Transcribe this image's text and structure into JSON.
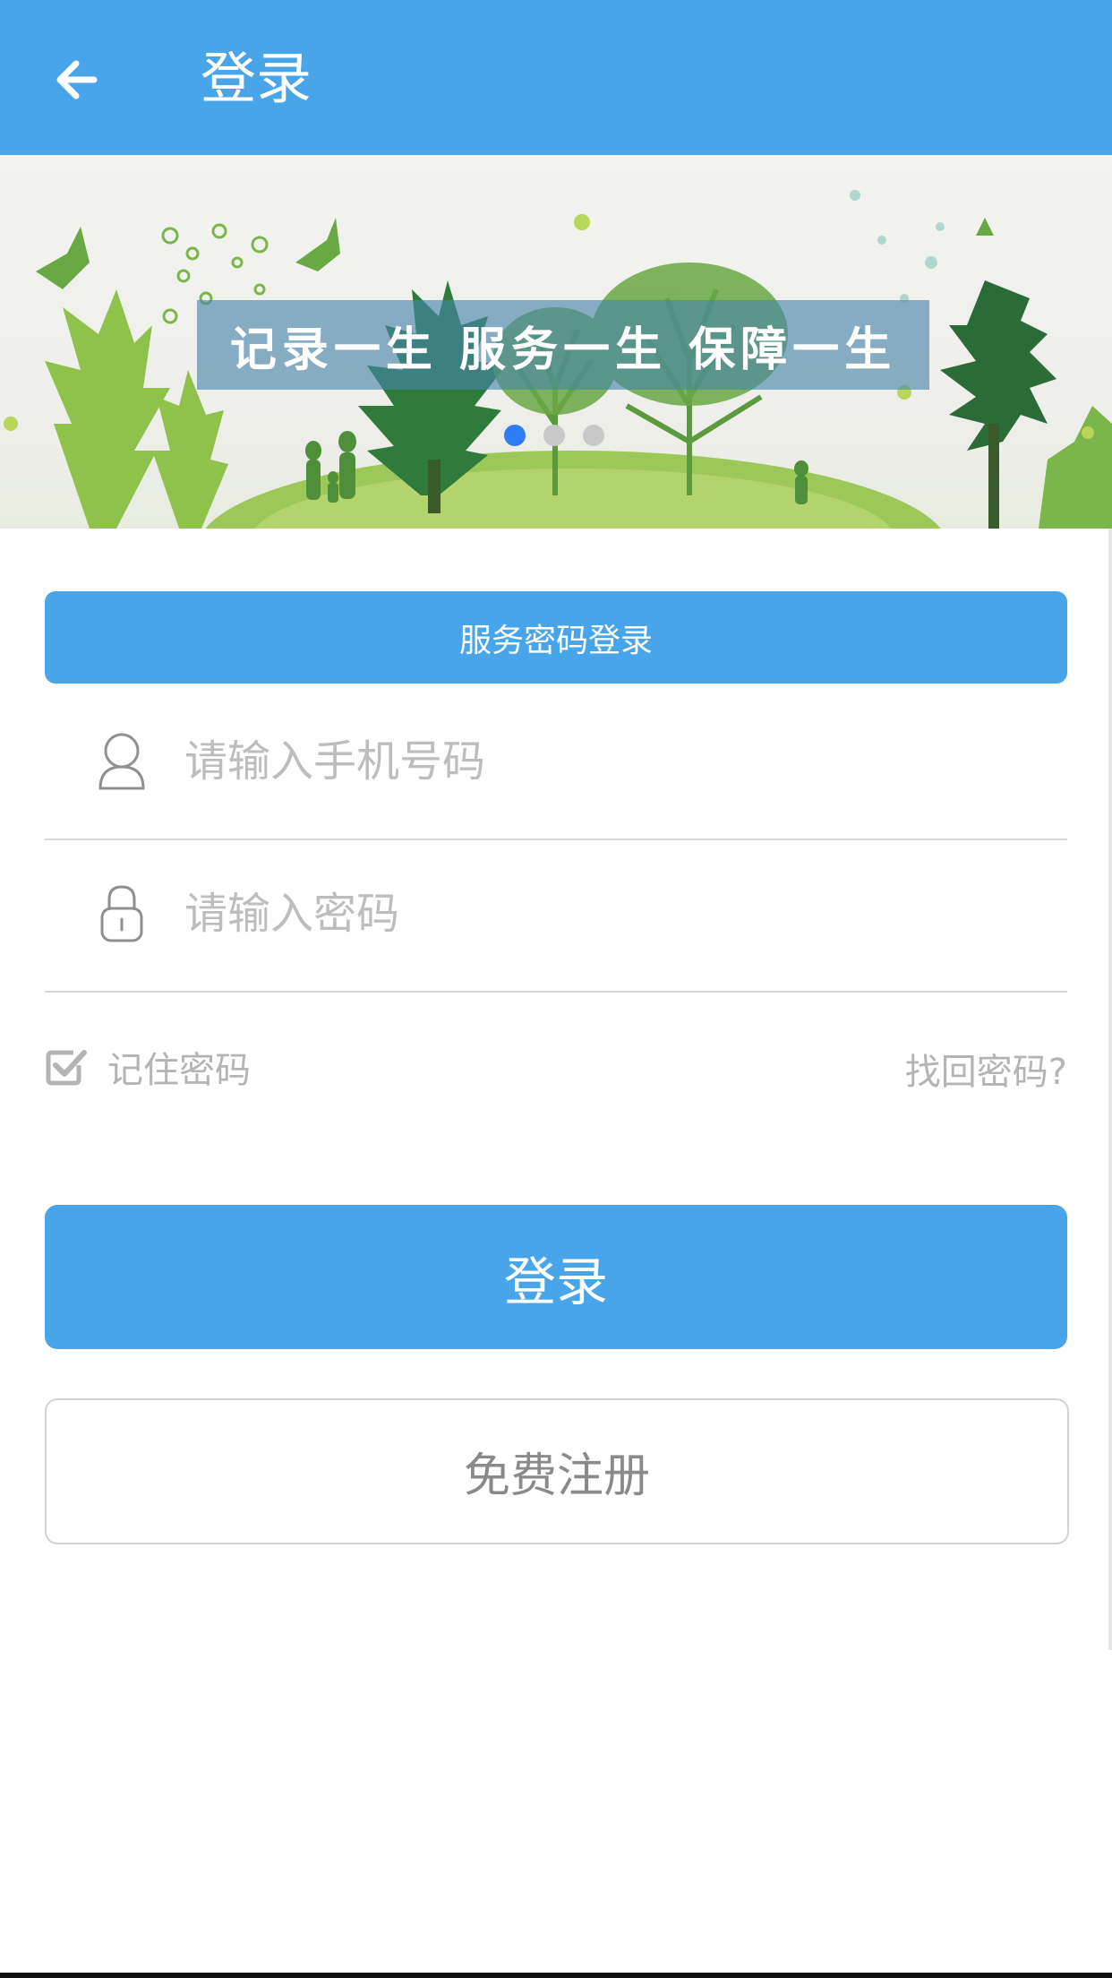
{
  "header": {
    "title": "登录"
  },
  "banner": {
    "caption": "记录一生 服务一生 保障一生",
    "slide_count": 3,
    "active_slide": 1
  },
  "login_mode": {
    "label": "服务密码登录"
  },
  "phone_field": {
    "value": "",
    "placeholder": "请输入手机号码"
  },
  "password_field": {
    "value": "",
    "placeholder": "请输入密码"
  },
  "remember": {
    "label": "记住密码",
    "checked": true
  },
  "forgot": {
    "label": "找回密码?"
  },
  "login_button": {
    "label": "登录"
  },
  "register_button": {
    "label": "免费注册"
  },
  "colors": {
    "primary": "#49a5ea",
    "dot_active": "#2e7cf6",
    "placeholder": "#bdbdbd"
  },
  "icons": {
    "back": "arrow-left-icon",
    "user": "user-icon",
    "lock": "lock-icon",
    "checkbox": "checkbox-checked-icon"
  }
}
